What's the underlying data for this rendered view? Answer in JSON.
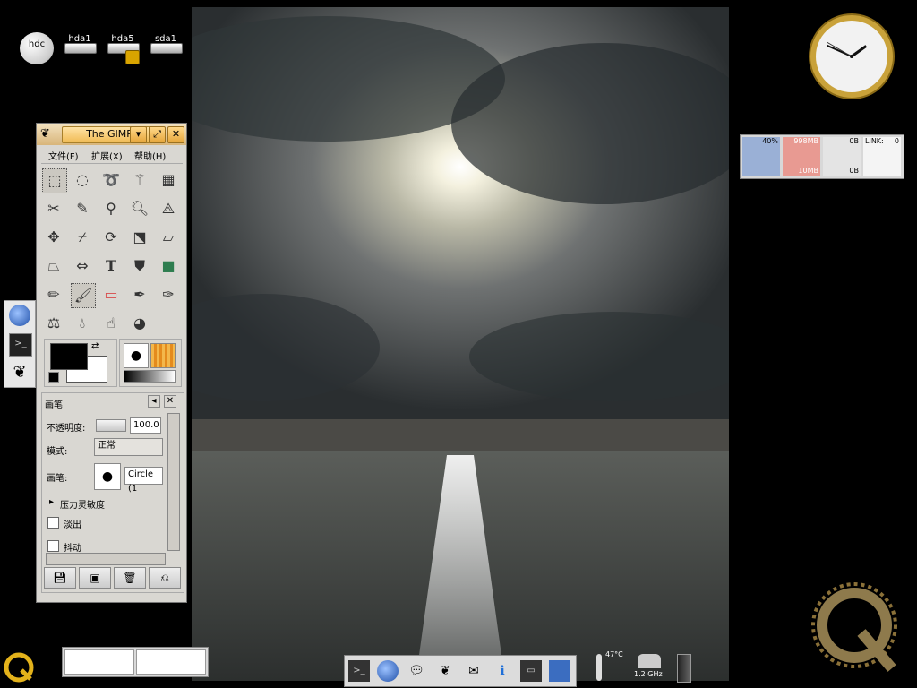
{
  "desktop": {
    "drives": [
      {
        "label": "hdc",
        "type": "cdrom"
      },
      {
        "label": "hda1",
        "type": "disk"
      },
      {
        "label": "hda5",
        "type": "disk",
        "locked": true
      },
      {
        "label": "sda1",
        "type": "disk"
      }
    ]
  },
  "clock": {
    "hour": 1,
    "minute": 49,
    "second": 50
  },
  "system_monitor": {
    "cpu_label": "40%",
    "mem_label": "998MB",
    "mem_sub": "10MB",
    "net_label": "0B",
    "net_sub": "0B",
    "link_label": "LINK:",
    "link_value": "0"
  },
  "gimp": {
    "title": "The GIMP",
    "menu": [
      "文件(F)",
      "扩展(X)",
      "帮助(H)"
    ],
    "tool_options_title": "画笔",
    "opacity_label": "不透明度:",
    "opacity_value": "100.0",
    "mode_label": "模式:",
    "mode_value": "正常",
    "brush_label": "画笔:",
    "brush_value": "Circle (1",
    "pressure_label": "压力灵敏度",
    "fade_label": "淡出",
    "jitter_label": "抖动",
    "accent_color": "#f0bb55"
  },
  "system_tray": {
    "temperature": "47°C",
    "cpu_freq": "1.2 GHz"
  },
  "icons": [
    "cd-icon",
    "disk-icon",
    "lock-icon",
    "clock-icon",
    "globe-icon",
    "terminal-icon",
    "gimp-icon",
    "kde-logo-icon",
    "trash-icon",
    "save-icon"
  ]
}
